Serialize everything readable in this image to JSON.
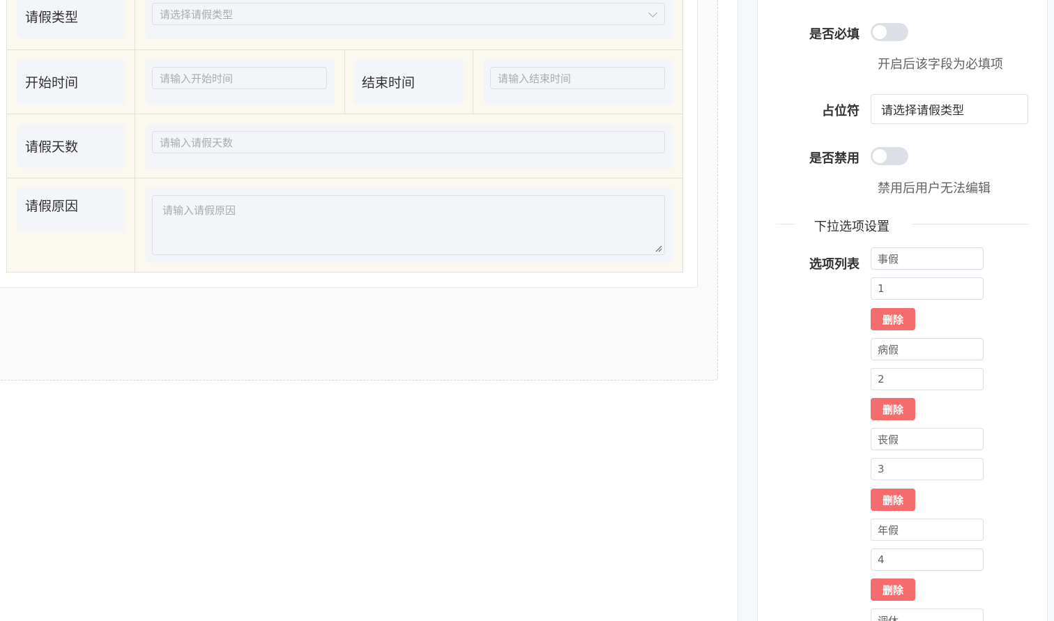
{
  "form": {
    "leave_type": {
      "label": "请假类型",
      "placeholder": "请选择请假类型"
    },
    "start_time": {
      "label": "开始时间",
      "placeholder": "请输入开始时间"
    },
    "end_time": {
      "label": "结束时间",
      "placeholder": "请输入结束时间"
    },
    "leave_days": {
      "label": "请假天数",
      "placeholder": "请输入请假天数"
    },
    "reason": {
      "label": "请假原因",
      "placeholder": "请输入请假原因"
    }
  },
  "props": {
    "required": {
      "label": "是否必填",
      "hint": "开启后该字段为必填项",
      "on": false
    },
    "placeholder": {
      "label": "占位符",
      "value": "请选择请假类型"
    },
    "disabled": {
      "label": "是否禁用",
      "hint": "禁用后用户无法编辑",
      "on": false
    },
    "options_section": "下拉选项设置",
    "options_label": "选项列表",
    "delete_label": "删除",
    "options": [
      {
        "label": "事假",
        "value": "1"
      },
      {
        "label": "病假",
        "value": "2"
      },
      {
        "label": "丧假",
        "value": "3"
      },
      {
        "label": "年假",
        "value": "4"
      },
      {
        "label": "调休"
      }
    ]
  },
  "colors": {
    "danger": "#f56c6c",
    "cell_bg": "#fbf8f0",
    "switch_off": "#dcdfe6"
  },
  "icons": {
    "select_arrow": "chevron-down-icon",
    "textarea_resize": "resize-grip-icon"
  }
}
